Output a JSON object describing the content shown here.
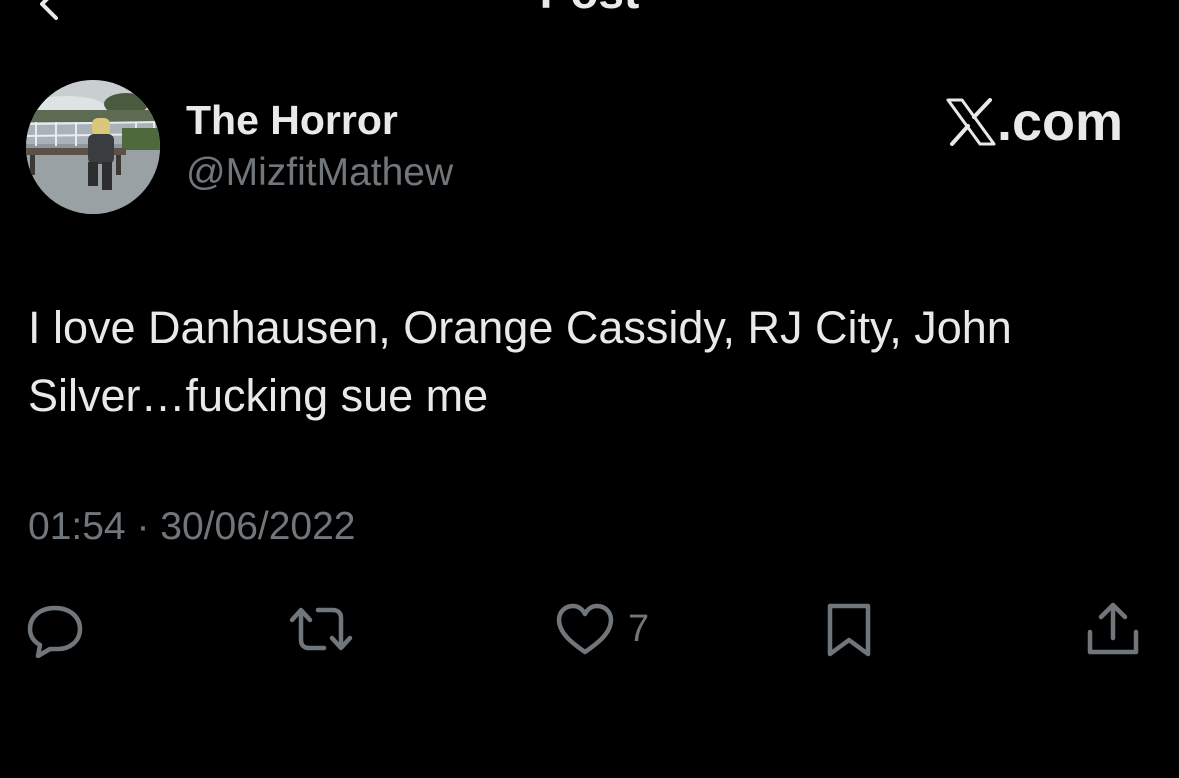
{
  "header": {
    "title": "Post",
    "back_icon": "chevron-left-icon"
  },
  "author": {
    "display_name": "The Horror",
    "handle": "@MizfitMathew"
  },
  "watermark": {
    "logo_icon": "x-logo-icon",
    "text": ".com"
  },
  "post": {
    "lines": [
      "I love Danhausen, Orange Cassidy, RJ City, John",
      "Silver…fucking sue me"
    ],
    "time": "01:54",
    "separator": "·",
    "date": "30/06/2022"
  },
  "actions": {
    "reply_icon": "reply-icon",
    "repost_icon": "repost-icon",
    "like_icon": "heart-icon",
    "like_count": "7",
    "bookmark_icon": "bookmark-icon",
    "share_icon": "share-icon"
  },
  "colors": {
    "background": "#000000",
    "primary_text": "#e7e9ea",
    "secondary_text": "#71767b"
  }
}
